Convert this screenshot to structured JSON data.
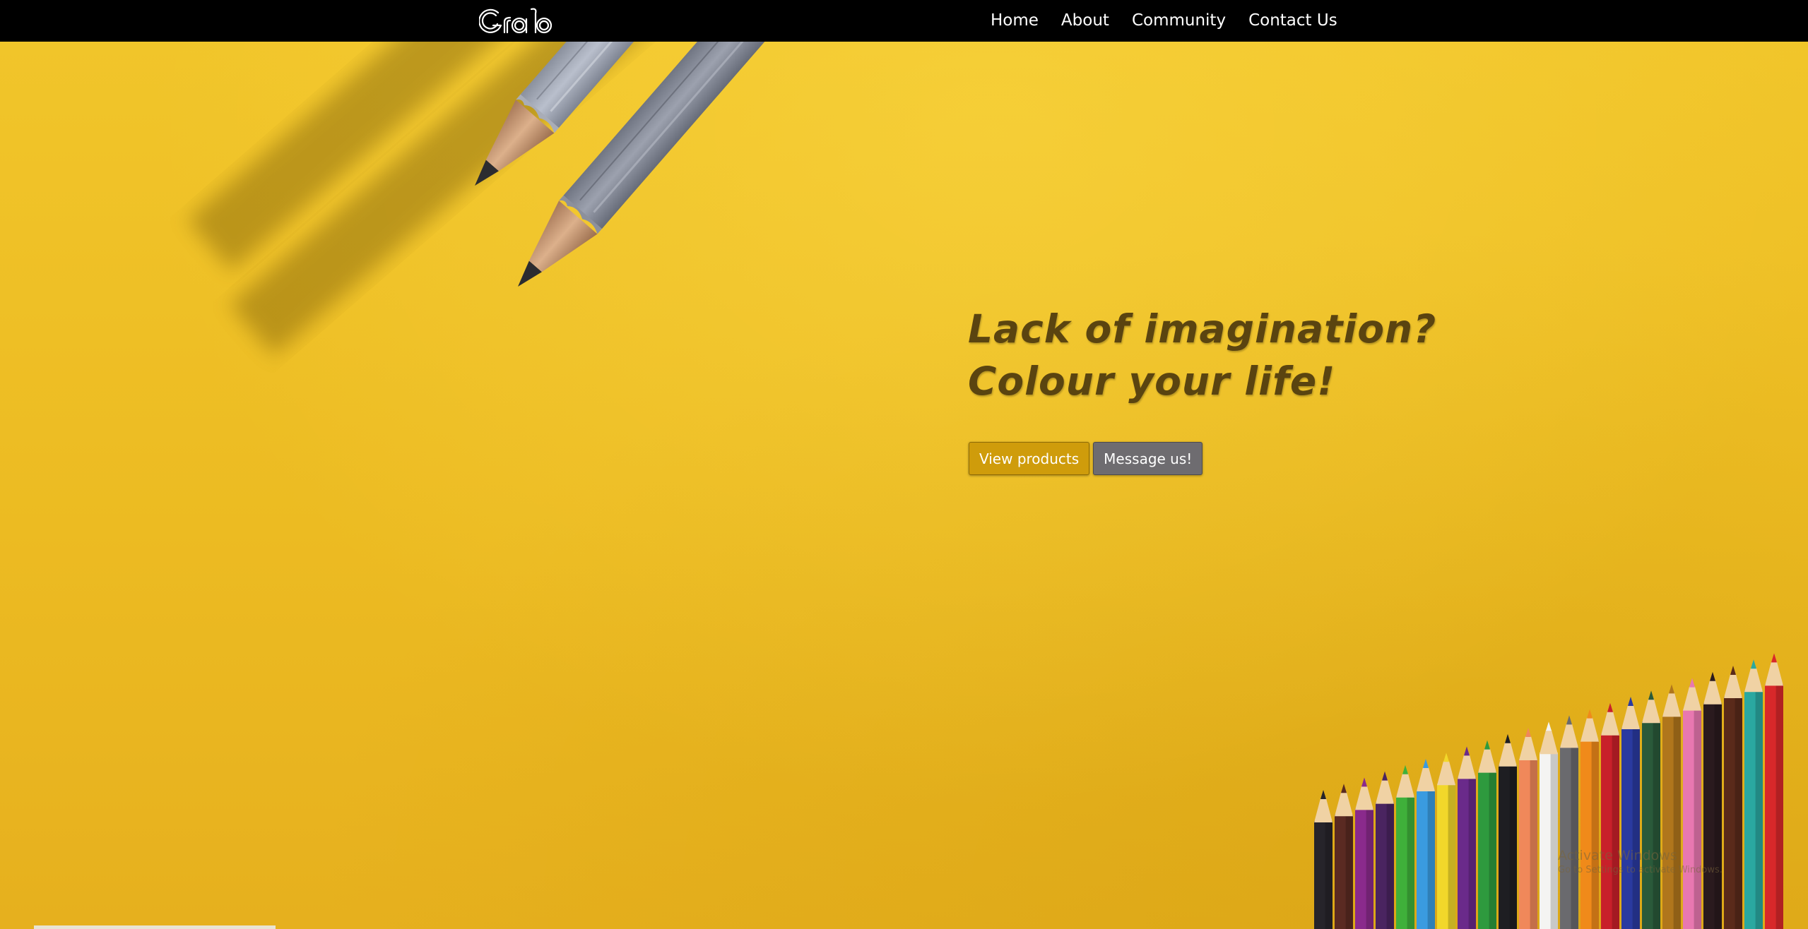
{
  "navbar": {
    "brand": "Grab",
    "links": [
      {
        "label": "Home"
      },
      {
        "label": "About"
      },
      {
        "label": "Community"
      },
      {
        "label": "Contact Us"
      }
    ]
  },
  "hero": {
    "headline_line1": "Lack of imagination?",
    "headline_line2": "Colour your life!",
    "primary_button": "View products",
    "secondary_button": "Message us!"
  },
  "watermark": {
    "title": "Activate Windows",
    "subtitle": "Go to Settings to activate Windows."
  },
  "colors": {
    "background_yellow": "#eebd25",
    "navbar": "#000000",
    "headline": "#5a4410",
    "primary_button": "#cf9c0b",
    "secondary_button": "#6e6c70"
  },
  "icons": {
    "brand_logo": "grab-logo",
    "hero_image": "pencils"
  }
}
